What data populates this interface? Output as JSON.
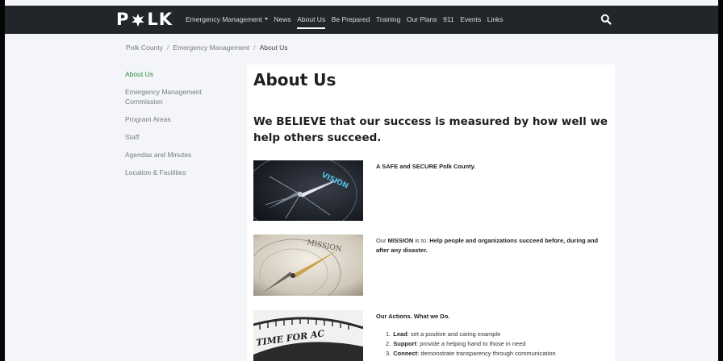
{
  "header": {
    "logo_left": "P",
    "logo_right": "LK",
    "nav": [
      {
        "label": "Emergency Management",
        "dropdown": true,
        "active": false
      },
      {
        "label": "News",
        "active": false
      },
      {
        "label": "About Us",
        "active": true
      },
      {
        "label": "Be Prepared",
        "active": false
      },
      {
        "label": "Training",
        "active": false
      },
      {
        "label": "Our Plans",
        "active": false
      },
      {
        "label": "911",
        "active": false
      },
      {
        "label": "Events",
        "active": false
      },
      {
        "label": "Links",
        "active": false
      }
    ],
    "search_icon": "search-icon"
  },
  "breadcrumb": [
    "Polk County",
    "Emergency Management",
    "About Us"
  ],
  "sidebar": {
    "items": [
      {
        "lines": [
          "About Us"
        ],
        "active": true
      },
      {
        "lines": [
          "Emergency Management",
          "Commission"
        ],
        "active": false
      },
      {
        "lines": [
          "Program Areas"
        ],
        "active": false
      },
      {
        "lines": [
          "Staff"
        ],
        "active": false
      },
      {
        "lines": [
          "Agendas and Minutes"
        ],
        "active": false
      },
      {
        "lines": [
          "Location & Facilities"
        ],
        "active": false
      }
    ]
  },
  "main": {
    "title": "About Us",
    "heading": "We BELIEVE that our success is measured by how well we help others succeed.",
    "vision": {
      "image_text": "VISION",
      "text": "A SAFE and SECURE Polk County."
    },
    "mission": {
      "image_text": "MISSION",
      "prefix": "Our ",
      "keyword": "MISSION",
      "middle": " is to: ",
      "statement": "Help people and organizations succeed before, during and after any disaster."
    },
    "actions": {
      "image_text": "TIME FOR AC",
      "heading": "Our Actions. What we Do.",
      "items": [
        {
          "num": "1.",
          "term": "Lead",
          "desc": ": set a positive and caring example"
        },
        {
          "num": "2.",
          "term": "Support",
          "desc": ": provide a helping hand to those in need"
        },
        {
          "num": "3.",
          "term": "Connect",
          "desc": ": demonstrate transparency through communication"
        }
      ]
    }
  },
  "colors": {
    "topbar": "#222529",
    "page": "#f4f5f8",
    "accent_green": "#2e8b3f",
    "panel": "#ffffff"
  }
}
